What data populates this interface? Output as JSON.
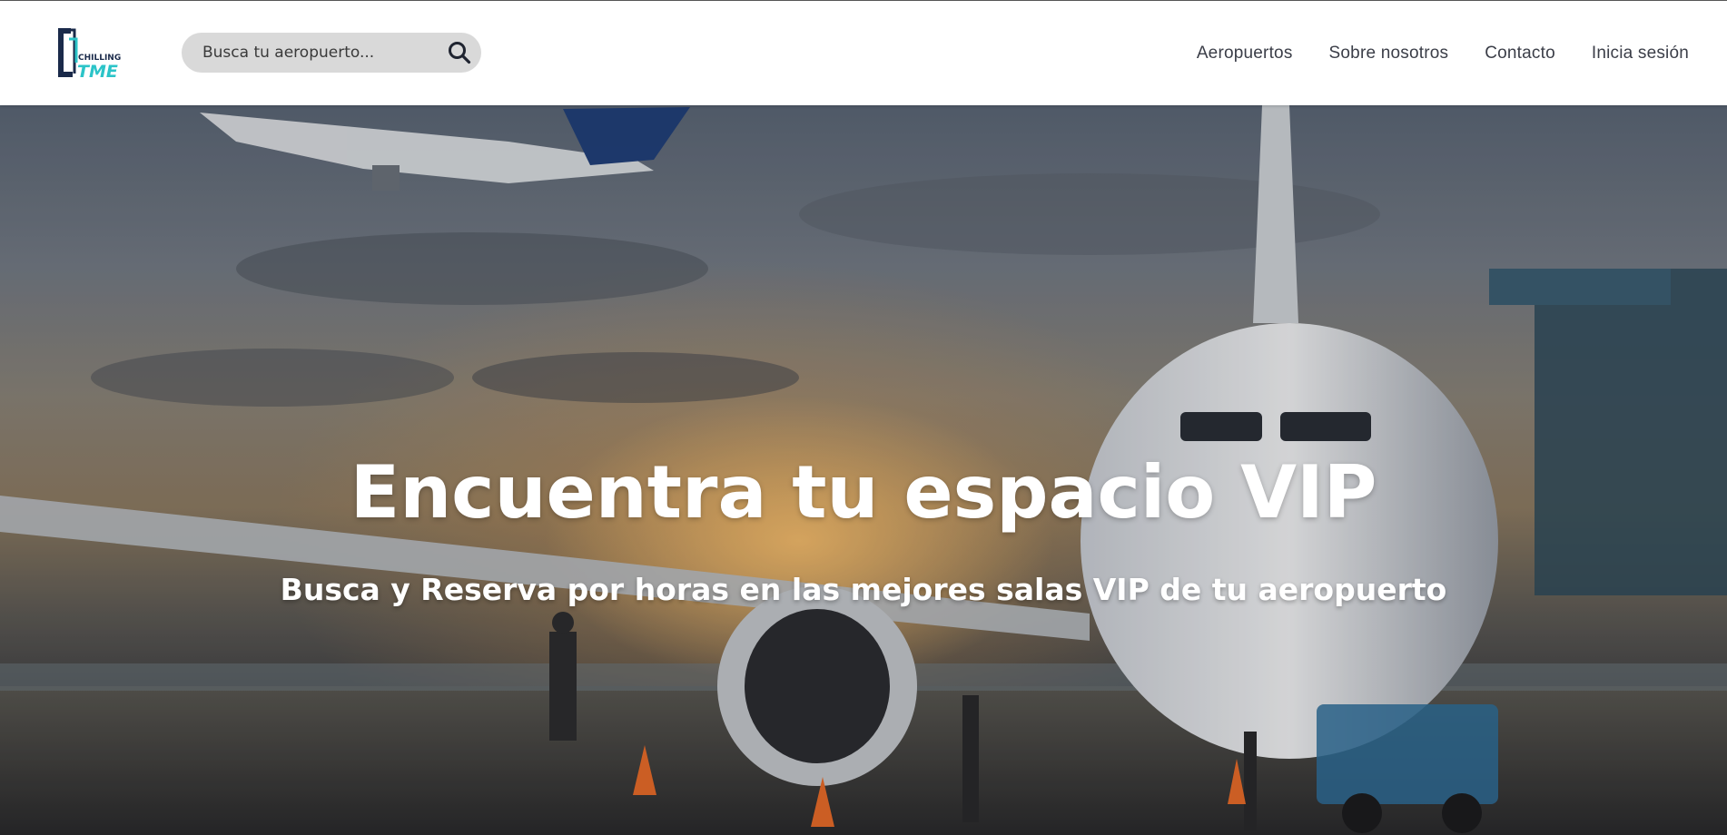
{
  "brand": {
    "logo_top": "CHILLING",
    "logo_bottom": "TME",
    "colors": {
      "dark": "#1a2a4a",
      "accent": "#2cc4c8"
    }
  },
  "search": {
    "placeholder": "Busca tu aeropuerto...",
    "value": "",
    "icon": "search-icon"
  },
  "nav": {
    "items": [
      {
        "label": "Aeropuertos"
      },
      {
        "label": "Sobre nosotros"
      },
      {
        "label": "Contacto"
      },
      {
        "label": "Inicia sesión"
      }
    ]
  },
  "hero": {
    "title": "Encuentra tu espacio VIP",
    "subtitle": "Busca y Reserva por horas en las mejores salas VIP de tu aeropuerto"
  }
}
